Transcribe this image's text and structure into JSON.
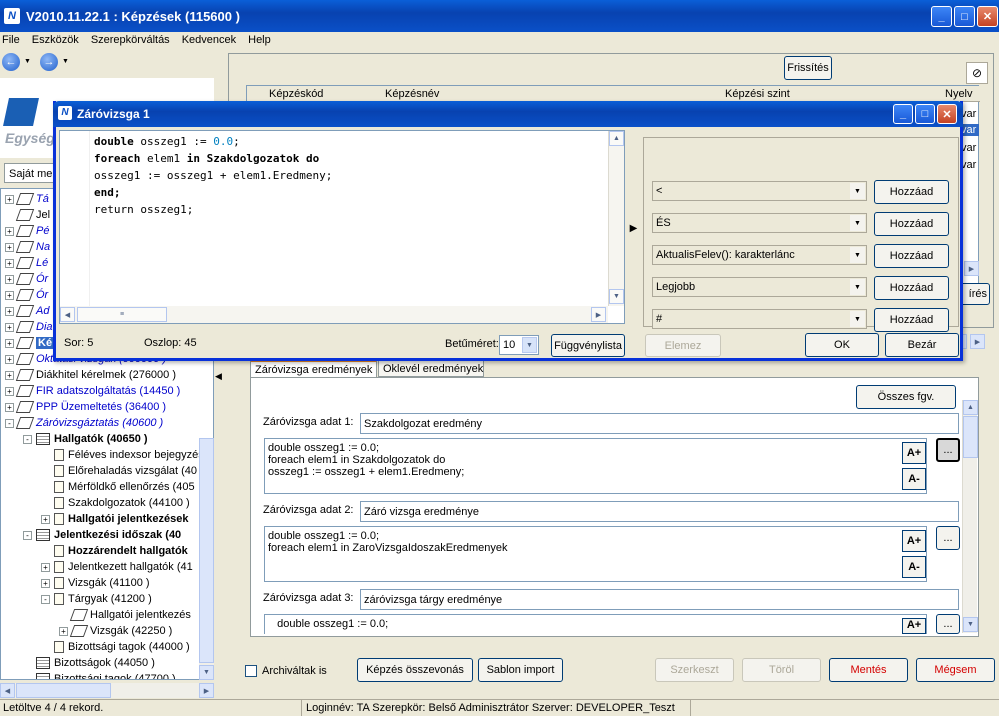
{
  "window": {
    "title": "V2010.11.22.1 : Képzések (115600  )"
  },
  "menu": [
    "File",
    "Eszközök",
    "Szerepkörváltás",
    "Kedvencek",
    "Help"
  ],
  "logo": {
    "tagline": "Egység"
  },
  "left": {
    "sajat_label": "Saját me",
    "tree": [
      {
        "d": 0,
        "pm": "+",
        "icon": "book",
        "text": "Tá",
        "cls": "blue italic"
      },
      {
        "d": 0,
        "pm": "",
        "icon": "book",
        "text": "Jel",
        "cls": ""
      },
      {
        "d": 0,
        "pm": "+",
        "icon": "book",
        "text": "Pé",
        "cls": "blue italic"
      },
      {
        "d": 0,
        "pm": "+",
        "icon": "book",
        "text": "Na",
        "cls": "blue italic"
      },
      {
        "d": 0,
        "pm": "+",
        "icon": "book",
        "text": "Lé",
        "cls": "blue italic"
      },
      {
        "d": 0,
        "pm": "+",
        "icon": "book",
        "text": "Ór",
        "cls": "blue italic"
      },
      {
        "d": 0,
        "pm": "+",
        "icon": "book",
        "text": "Ór",
        "cls": "blue italic"
      },
      {
        "d": 0,
        "pm": "+",
        "icon": "book",
        "text": "Ad",
        "cls": "blue italic"
      },
      {
        "d": 0,
        "pm": "+",
        "icon": "book",
        "text": "Dia",
        "cls": "blue italic"
      },
      {
        "d": 0,
        "pm": "+",
        "icon": "book",
        "text": "Ké",
        "cls": "sel"
      },
      {
        "d": 0,
        "pm": "+",
        "icon": "book",
        "text": "Oktatási vizsgák (000000 )",
        "cls": "blue italic"
      },
      {
        "d": 0,
        "pm": "+",
        "icon": "book",
        "text": "Diákhitel kérelmek (276000  )",
        "cls": ""
      },
      {
        "d": 0,
        "pm": "+",
        "icon": "book",
        "text": "FIR adatszolgáltatás (14450  )",
        "cls": "blue"
      },
      {
        "d": 0,
        "pm": "+",
        "icon": "book",
        "text": "PPP Üzemeltetés (36400  )",
        "cls": "blue"
      },
      {
        "d": 0,
        "pm": "-",
        "icon": "book",
        "text": "Záróvizsgáztatás (40600  )",
        "cls": "blue italic"
      },
      {
        "d": 1,
        "pm": "-",
        "icon": "cert",
        "text": "Hallgatók (40650  )",
        "cls": "bold"
      },
      {
        "d": 2,
        "pm": "",
        "icon": "doc",
        "text": "Féléves indexsor bejegyzés",
        "cls": ""
      },
      {
        "d": 2,
        "pm": "",
        "icon": "doc",
        "text": "Előrehaladás vizsgálat (40",
        "cls": ""
      },
      {
        "d": 2,
        "pm": "",
        "icon": "doc",
        "text": "Mérföldkő ellenőrzés (405",
        "cls": ""
      },
      {
        "d": 2,
        "pm": "",
        "icon": "doc",
        "text": "Szakdolgozatok (44100  )",
        "cls": ""
      },
      {
        "d": 2,
        "pm": "+",
        "icon": "doc",
        "text": "Hallgatói jelentkezések",
        "cls": "bold"
      },
      {
        "d": 1,
        "pm": "-",
        "icon": "cert",
        "text": "Jelentkezési időszak (40",
        "cls": "bold"
      },
      {
        "d": 2,
        "pm": "",
        "icon": "doc",
        "text": "Hozzárendelt hallgatók",
        "cls": "bold"
      },
      {
        "d": 2,
        "pm": "+",
        "icon": "doc",
        "text": "Jelentkezett hallgatók (41",
        "cls": ""
      },
      {
        "d": 2,
        "pm": "+",
        "icon": "doc",
        "text": "Vizsgák (41100  )",
        "cls": ""
      },
      {
        "d": 2,
        "pm": "-",
        "icon": "doc",
        "text": "Tárgyak (41200  )",
        "cls": ""
      },
      {
        "d": 3,
        "pm": "",
        "icon": "book",
        "text": "Hallgatói jelentkezés",
        "cls": ""
      },
      {
        "d": 3,
        "pm": "+",
        "icon": "book",
        "text": "Vizsgák (42250  )",
        "cls": ""
      },
      {
        "d": 2,
        "pm": "",
        "icon": "doc",
        "text": "Bizottsági tagok (44000  )",
        "cls": ""
      },
      {
        "d": 1,
        "pm": "",
        "icon": "cert",
        "text": "Bizottságok (44050  )",
        "cls": ""
      },
      {
        "d": 1,
        "pm": "",
        "icon": "cert",
        "text": "Bizottsági tagok (47700  )",
        "cls": ""
      }
    ]
  },
  "top_grid": {
    "refresh_label": "Frissítés",
    "columns": [
      "Képzéskód",
      "Képzésnév",
      "Képzési szint",
      "Nyelv"
    ],
    "lang_cells": [
      "var",
      "var",
      "var",
      "var"
    ],
    "side_btn": "írés"
  },
  "tabs": [
    "Záróvizsga eredmények",
    "Oklevél eredmények"
  ],
  "panel": {
    "osszes_fgv": "Összes fgv.",
    "rows": [
      {
        "label": "Záróvizsga adat 1:",
        "value": "Szakdolgozat eredmény",
        "code": "double osszeg1 := 0.0;\nforeach elem1 in Szakdolgozatok do\nosszeg1 := osszeg1 + elem1.Eredmeny;"
      },
      {
        "label": "Záróvizsga adat 2:",
        "value": "Záró vizsga eredménye",
        "code": "double osszeg1 := 0.0;\nforeach elem1 in ZaroVizsgaIdoszakEredmenyek"
      },
      {
        "label": "Záróvizsga adat 3:",
        "value": "záróvizsga tárgy eredménye",
        "code": "   double osszeg1 := 0.0;"
      }
    ],
    "a_plus": "A+",
    "a_minus": "A-",
    "ellipsis": "..."
  },
  "bottom": {
    "archived": "Archiváltak is",
    "btn_kepzes": "Képzés összevonás",
    "btn_sablon": "Sablon import",
    "btn_szerkeszt": "Szerkeszt",
    "btn_torol": "Töröl",
    "btn_mentes": "Mentés",
    "btn_megsem": "Mégsem"
  },
  "status": {
    "records": "Letöltve 4 / 4 rekord.",
    "login": "Loginnév: TA  Szerepkör: Belső Adminisztrátor  Szerver: DEVELOPER_Teszt"
  },
  "dialog": {
    "title": "Záróvizsga 1",
    "code_lines": [
      {
        "a": "double ",
        "b": "osszeg1 := ",
        "c": "0.0",
        ";": ";"
      },
      {
        "a": "foreach ",
        "b": "elem1 ",
        "c2": "in ",
        "d": "Szakdolgozatok do"
      },
      {
        "p": "osszeg1 := osszeg1 + elem1.Eredmeny;"
      },
      {
        "a": "end;"
      },
      {
        "p": "return osszeg1;"
      }
    ],
    "combos": [
      "<",
      "ÉS",
      "AktualisFelev(): karakterlánc",
      "Legjobb",
      "#"
    ],
    "hozzaad": "Hozzáad",
    "sor": "Sor: 5",
    "oszlop": "Oszlop: 45",
    "betumeret_label": "Betűméret:",
    "betumeret_value": "10",
    "fuggvenylista": "Függvénylista",
    "elemez": "Elemez",
    "ok": "OK",
    "bezar": "Bezár"
  }
}
